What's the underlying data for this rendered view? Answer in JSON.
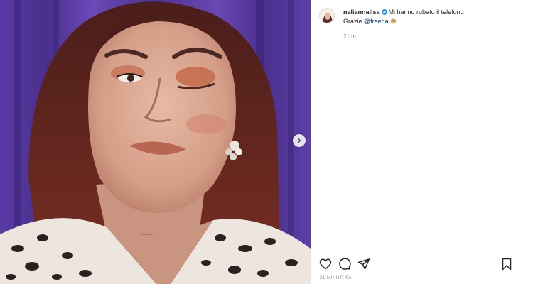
{
  "post": {
    "username": "naliannalisa",
    "caption_line1": "Mi hanno rubato il telefono",
    "caption_prefix": "Grazie ",
    "mention": "@freeda",
    "emoji_icon": "facepunch-emoji",
    "time_relative": "21 m",
    "timestamp": "21 MINUTI FA"
  },
  "colors": {
    "link": "#00376b",
    "verified": "#3897f0",
    "muted": "#8e8e8e",
    "background_curtain": "#5b3fa0"
  },
  "icons": {
    "like": "heart-icon",
    "comment": "comment-icon",
    "share": "send-icon",
    "save": "bookmark-icon",
    "next": "chevron-right-icon",
    "verified": "verified-badge-icon"
  }
}
